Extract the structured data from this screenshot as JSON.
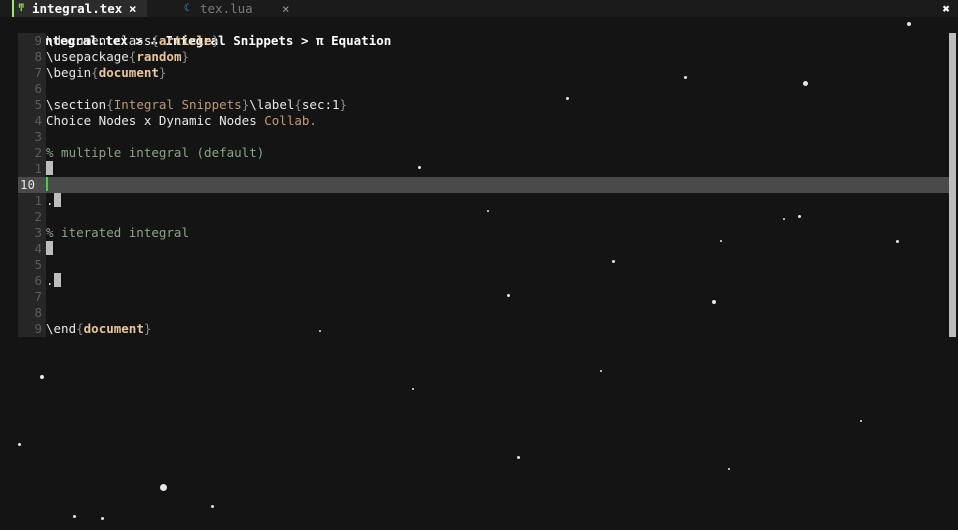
{
  "tabs": [
    {
      "icon": "tex-file-icon",
      "glyph": "ͳ",
      "name": "integral.tex",
      "close": "×",
      "active": true
    },
    {
      "icon": "lua-file-icon",
      "glyph": "☾",
      "name": "tex.lua",
      "close": "×",
      "active": false
    }
  ],
  "window_close": "✖",
  "breadcrumb": {
    "icon_glyph": "ͳ",
    "file": "integral.tex",
    "sep1": " > ",
    "section_glyph": "∴",
    "section": "Integral Snippets",
    "sep2": " > ",
    "equation_glyph": "π",
    "equation": "Equation"
  },
  "editor": {
    "lines": [
      {
        "num": "9",
        "parts": [
          {
            "t": "\\documentclass",
            "c": "kw"
          },
          {
            "t": "{",
            "c": "br"
          },
          {
            "t": "article",
            "c": "arg"
          },
          {
            "t": "}",
            "c": "br"
          }
        ]
      },
      {
        "num": "8",
        "parts": [
          {
            "t": "\\usepackage",
            "c": "kw"
          },
          {
            "t": "{",
            "c": "br"
          },
          {
            "t": "random",
            "c": "arg"
          },
          {
            "t": "}",
            "c": "br"
          }
        ]
      },
      {
        "num": "7",
        "parts": [
          {
            "t": "\\begin",
            "c": "kw"
          },
          {
            "t": "{",
            "c": "br"
          },
          {
            "t": "document",
            "c": "arg"
          },
          {
            "t": "}",
            "c": "br"
          }
        ]
      },
      {
        "num": "6",
        "parts": []
      },
      {
        "num": "5",
        "parts": [
          {
            "t": "\\section",
            "c": "kw"
          },
          {
            "t": "{",
            "c": "br"
          },
          {
            "t": "Integral Snippets",
            "c": "sarg"
          },
          {
            "t": "}",
            "c": "br"
          },
          {
            "t": "\\label",
            "c": "kw"
          },
          {
            "t": "{",
            "c": "br"
          },
          {
            "t": "sec:1",
            "c": "kw"
          },
          {
            "t": "}",
            "c": "br"
          }
        ]
      },
      {
        "num": "4",
        "parts": [
          {
            "t": "Choice Nodes x Dynamic Nodes ",
            "c": "kw"
          },
          {
            "t": "Collab.",
            "c": "orange"
          }
        ]
      },
      {
        "num": "3",
        "parts": []
      },
      {
        "num": "2",
        "parts": [
          {
            "t": "% multiple integral (default)",
            "c": "cmt"
          }
        ]
      },
      {
        "num": "1",
        "parts": [],
        "block": true
      },
      {
        "num": "10",
        "parts": [],
        "current": true
      },
      {
        "num": "1",
        "parts": [
          {
            "t": ".",
            "c": "kw"
          }
        ],
        "block": true
      },
      {
        "num": "2",
        "parts": []
      },
      {
        "num": "3",
        "parts": [
          {
            "t": "% iterated integral",
            "c": "cmt"
          }
        ]
      },
      {
        "num": "4",
        "parts": [],
        "block": true
      },
      {
        "num": "5",
        "parts": []
      },
      {
        "num": "6",
        "parts": [
          {
            "t": ".",
            "c": "kw"
          }
        ],
        "block": true
      },
      {
        "num": "7",
        "parts": []
      },
      {
        "num": "8",
        "parts": []
      },
      {
        "num": "9",
        "parts": [
          {
            "t": "\\end",
            "c": "kw"
          },
          {
            "t": "{",
            "c": "br"
          },
          {
            "t": "document",
            "c": "arg"
          },
          {
            "t": "}",
            "c": "br"
          }
        ]
      }
    ]
  }
}
